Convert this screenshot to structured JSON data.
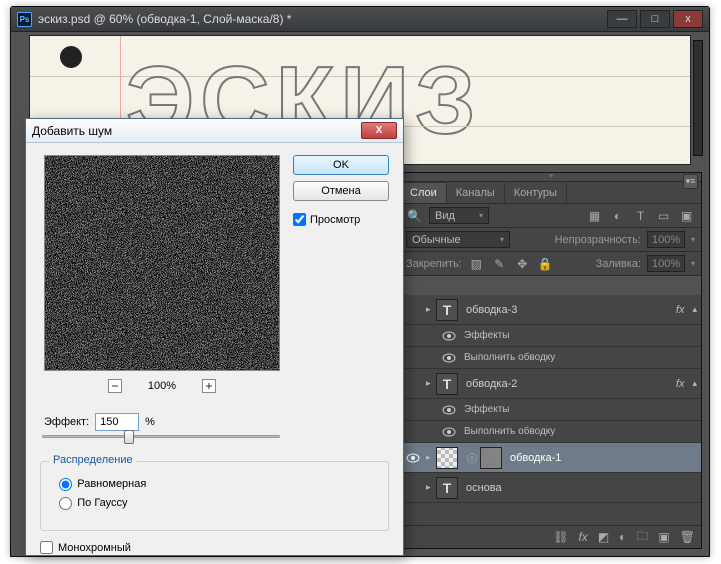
{
  "app": {
    "title": "эскиз.psd @ 60% (обводка-1, Слой-маска/8) *",
    "canvas_text": "ЭСКИЗ"
  },
  "dialog": {
    "title": "Добавить шум",
    "ok": "OK",
    "cancel": "Отмена",
    "preview_label": "Просмотр",
    "preview_checked": true,
    "zoom": "100%",
    "amount_label": "Эффект:",
    "amount_value": "150",
    "amount_unit": "%",
    "distribution_label": "Распределение",
    "dist_uniform": "Равномерная",
    "dist_gauss": "По Гауссу",
    "dist_selected": "uniform",
    "mono_label": "Монохромный",
    "mono_checked": false
  },
  "panel": {
    "tabs": [
      "Слои",
      "Каналы",
      "Контуры"
    ],
    "active_tab": 0,
    "kind_label": "Вид",
    "blend_mode": "Обычные",
    "opacity_label": "Непрозрачность:",
    "opacity_value": "100%",
    "lock_label": "Закрепить:",
    "fill_label": "Заливка:",
    "fill_value": "100%",
    "layers": [
      {
        "name": "обводка-3",
        "type": "T",
        "visible": false,
        "fx": true
      },
      {
        "name": "Эффекты",
        "type": "sub",
        "visible": true
      },
      {
        "name": "Выполнить обводку",
        "type": "sub",
        "visible": true
      },
      {
        "name": "обводка-2",
        "type": "T",
        "visible": false,
        "fx": true
      },
      {
        "name": "Эффекты",
        "type": "sub",
        "visible": true
      },
      {
        "name": "Выполнить обводку",
        "type": "sub",
        "visible": true
      },
      {
        "name": "обводка-1",
        "type": "mask",
        "visible": true,
        "selected": true,
        "link": true
      },
      {
        "name": "основа",
        "type": "T",
        "visible": false
      }
    ]
  }
}
